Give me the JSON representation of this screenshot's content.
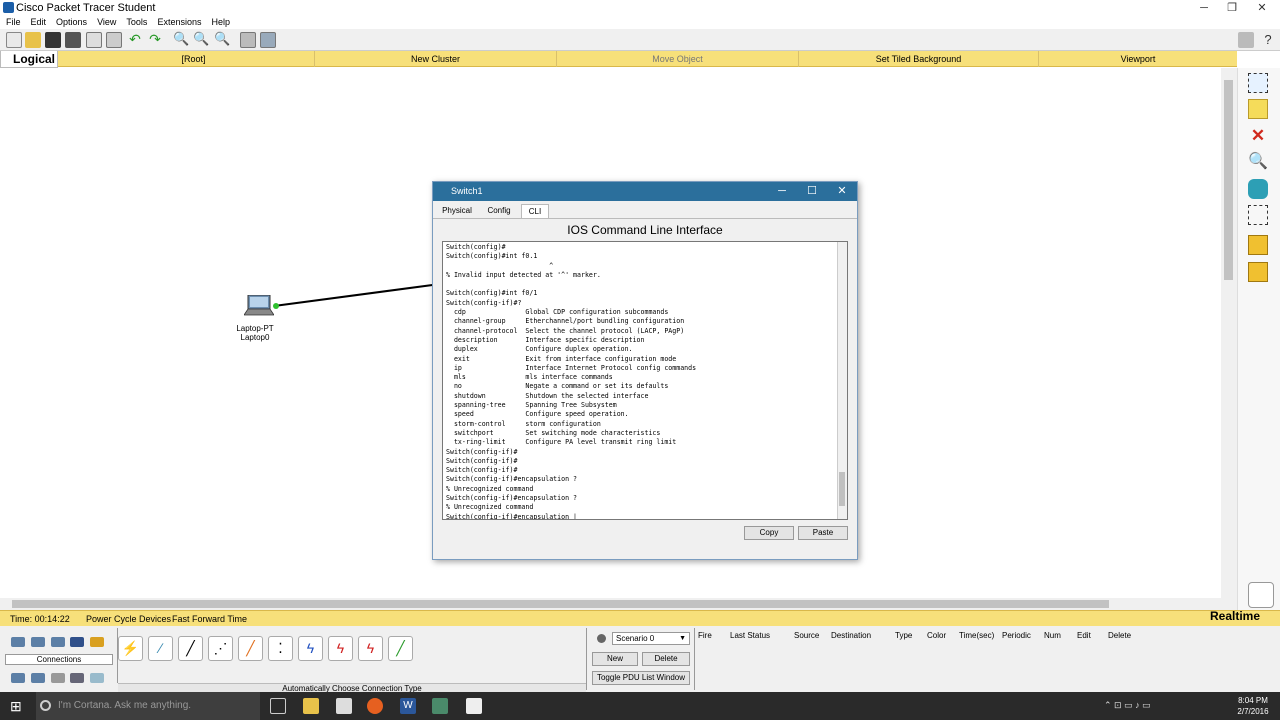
{
  "window": {
    "title": "Cisco Packet Tracer Student"
  },
  "menu": [
    "File",
    "Edit",
    "Options",
    "View",
    "Tools",
    "Extensions",
    "Help"
  ],
  "navbar": {
    "logical": "Logical",
    "items": [
      "[Root]",
      "New Cluster",
      "Move Object",
      "Set Tiled Background",
      "Viewport"
    ]
  },
  "devices": [
    {
      "type": "Laptop-PT",
      "name": "Laptop0"
    }
  ],
  "dialog": {
    "title": "Switch1",
    "tabs": [
      "Physical",
      "Config",
      "CLI"
    ],
    "active_tab": "CLI",
    "heading": "IOS Command Line Interface",
    "cli_text": "Switch(config)#\nSwitch(config)#int f0.1\n                          ^\n% Invalid input detected at '^' marker.\n\nSwitch(config)#int f0/1\nSwitch(config-if)#?\n  cdp               Global CDP configuration subcommands\n  channel-group     Etherchannel/port bundling configuration\n  channel-protocol  Select the channel protocol (LACP, PAgP)\n  description       Interface specific description\n  duplex            Configure duplex operation.\n  exit              Exit from interface configuration mode\n  ip                Interface Internet Protocol config commands\n  mls               mls interface commands\n  no                Negate a command or set its defaults\n  shutdown          Shutdown the selected interface\n  spanning-tree     Spanning Tree Subsystem\n  speed             Configure speed operation.\n  storm-control     storm configuration\n  switchport        Set switching mode characteristics\n  tx-ring-limit     Configure PA level transmit ring limit\nSwitch(config-if)#\nSwitch(config-if)#\nSwitch(config-if)#\nSwitch(config-if)#encapsulation ?\n% Unrecognized command\nSwitch(config-if)#encapsulation ?\n% Unrecognized command\nSwitch(config-if)#encapsulation |",
    "copy_label": "Copy",
    "paste_label": "Paste"
  },
  "statusbar": {
    "time": "Time: 00:14:22",
    "power_cycle": "Power Cycle Devices",
    "fast_forward": "Fast Forward Time",
    "realtime": "Realtime"
  },
  "bottom": {
    "category": "Connections",
    "connection_hint": "Automatically Choose Connection Type",
    "scenario": "Scenario 0",
    "new_label": "New",
    "delete_label": "Delete",
    "toggle_label": "Toggle PDU List Window",
    "pdu_columns": [
      "Fire",
      "Last Status",
      "Source",
      "Destination",
      "Type",
      "Color",
      "Time(sec)",
      "Periodic",
      "Num",
      "Edit",
      "Delete"
    ]
  },
  "taskbar": {
    "cortana_placeholder": "I'm Cortana. Ask me anything.",
    "time": "8:04 PM",
    "date": "2/7/2016"
  }
}
